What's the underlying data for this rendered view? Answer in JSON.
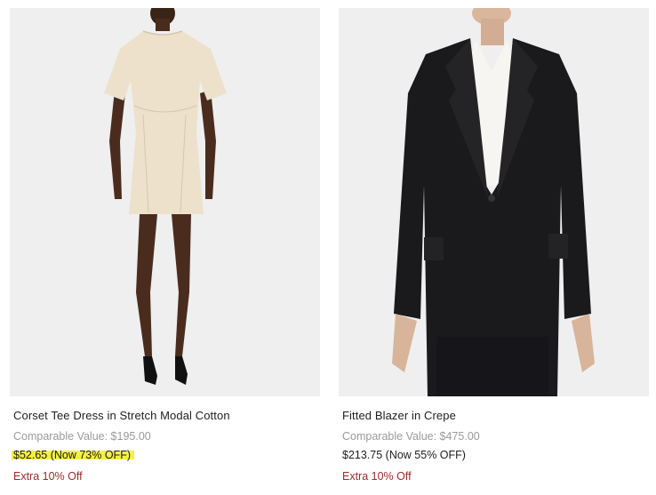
{
  "products": [
    {
      "name": "Corset Tee Dress in Stretch Modal Cotton",
      "comparable": "Comparable Value: $195.00",
      "price": "$52.65 (Now 73% OFF)",
      "promo": "Extra 10% Off",
      "price_highlighted": true
    },
    {
      "name": "Fitted Blazer in Crepe",
      "comparable": "Comparable Value: $475.00",
      "price": "$213.75 (Now 55% OFF)",
      "promo": "Extra 10% Off",
      "price_highlighted": false
    }
  ],
  "colors": {
    "photo_bg": "#efefef",
    "promo": "#9b2a2a",
    "comparable": "#9a9a9a",
    "highlight": "#f2ef3e"
  }
}
